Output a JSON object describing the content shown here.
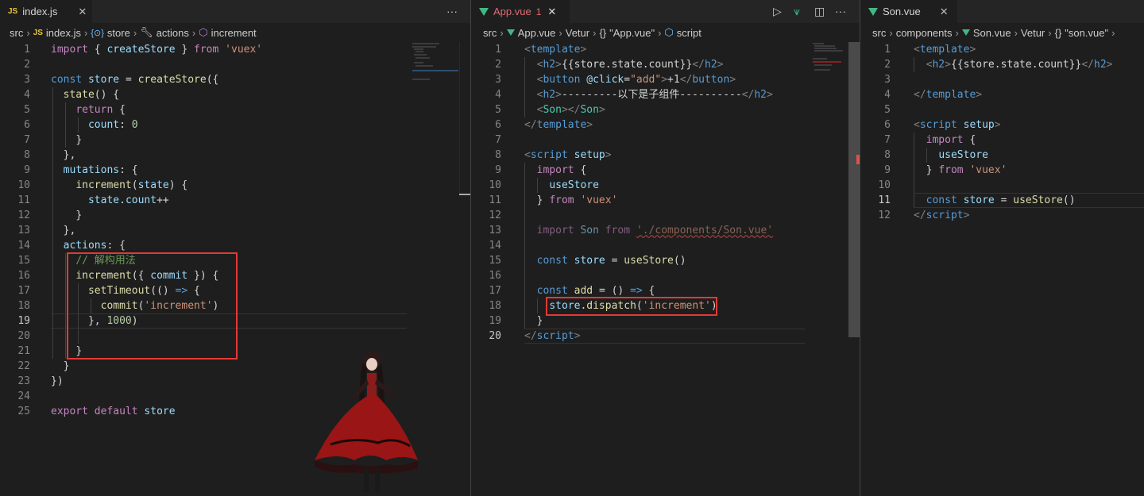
{
  "pane1": {
    "tab": {
      "icon": "JS",
      "title": "index.js"
    },
    "more": "···",
    "breadcrumb": [
      "src",
      "JS",
      "index.js",
      "{⊙}",
      "store",
      "actions",
      "increment"
    ],
    "lines": [
      "1",
      "2",
      "3",
      "4",
      "5",
      "6",
      "7",
      "8",
      "9",
      "10",
      "11",
      "12",
      "13",
      "14",
      "15",
      "16",
      "17",
      "18",
      "19",
      "20",
      "21",
      "22",
      "23",
      "24",
      "25"
    ],
    "code": {
      "l1a": "import",
      "l1b": "{ ",
      "l1c": "createStore",
      "l1d": " } ",
      "l1e": "from",
      "l1f": "'vuex'",
      "l3a": "const",
      "l3b": "store",
      "l3c": "=",
      "l3d": "createStore",
      "l3e": "({",
      "l4a": "state",
      "l4b": "() {",
      "l5a": "return",
      "l5b": " {",
      "l6a": "count",
      "l6b": ": ",
      "l6c": "0",
      "l7": "}",
      "l8": "},",
      "l9a": "mutations",
      "l9b": ": {",
      "l10a": "increment",
      "l10b": "(",
      "l10c": "state",
      "l10d": ") {",
      "l11a": "state",
      "l11b": ".",
      "l11c": "count",
      "l11d": "++",
      "l12": "}",
      "l13": "},",
      "l14a": "actions",
      "l14b": ": {",
      "l15": "// 解构用法",
      "l16a": "increment",
      "l16b": "({ ",
      "l16c": "commit",
      "l16d": " }) {",
      "l17a": "setTimeout",
      "l17b": "(() ",
      "l17c": "=>",
      "l17d": " {",
      "l18a": "commit",
      "l18b": "(",
      "l18c": "'increment'",
      "l18d": ")",
      "l19a": "}, ",
      "l19b": "1000",
      "l19c": ")",
      "l21": "}",
      "l22": "}",
      "l23": "})",
      "l25a": "export",
      "l25b": "default",
      "l25c": "store"
    }
  },
  "pane2": {
    "tab": {
      "title": "App.vue",
      "modified": "1"
    },
    "breadcrumb": [
      "src",
      "App.vue",
      "Vetur",
      "{}",
      "\"App.vue\"",
      "script"
    ],
    "lines": [
      "1",
      "2",
      "3",
      "4",
      "5",
      "6",
      "7",
      "8",
      "9",
      "10",
      "11",
      "12",
      "13",
      "14",
      "15",
      "16",
      "17",
      "18",
      "19",
      "20"
    ],
    "code": {
      "l1": "template",
      "l2a": "h2",
      "l2b": "{{store.state.count}}",
      "l2c": "h2",
      "l3a": "button",
      "l3b": "@click",
      "l3c": "=",
      "l3d": "\"add\"",
      "l3e": "+1",
      "l3f": "button",
      "l4a": "h2",
      "l4b": "---------以下是子组件----------",
      "l4c": "h2",
      "l5a": "Son",
      "l5b": "Son",
      "l6": "template",
      "l8a": "script",
      "l8b": "setup",
      "l9a": "import",
      "l9b": " {",
      "l10": "useStore",
      "l11a": "} ",
      "l11b": "from",
      "l11c": "'vuex'",
      "l13a": "import",
      "l13b": "Son",
      "l13c": "from",
      "l13d": "'./components/Son.vue'",
      "l15a": "const",
      "l15b": "store",
      "l15c": "=",
      "l15d": "useStore",
      "l15e": "()",
      "l17a": "const",
      "l17b": "add",
      "l17c": "= () ",
      "l17d": "=>",
      "l17e": " {",
      "l18a": "store",
      "l18b": ".",
      "l18c": "dispatch",
      "l18d": "(",
      "l18e": "'increment'",
      "l18f": ")",
      "l19": "}",
      "l20": "script"
    }
  },
  "pane3": {
    "tab": {
      "title": "Son.vue"
    },
    "breadcrumb": [
      "src",
      "components",
      "Son.vue",
      "Vetur",
      "{}",
      "\"son.vue\""
    ],
    "lines": [
      "1",
      "2",
      "3",
      "4",
      "5",
      "6",
      "7",
      "8",
      "9",
      "10",
      "11",
      "12"
    ],
    "code": {
      "l1": "template",
      "l2a": "h2",
      "l2b": "{{store.state.count}}",
      "l2c": "h2",
      "l4": "template",
      "l6a": "script",
      "l6b": "setup",
      "l7a": "import",
      "l7b": " {",
      "l8": "useStore",
      "l9a": "} ",
      "l9b": "from",
      "l9c": "'vuex'",
      "l11a": "const",
      "l11b": "store",
      "l11c": "=",
      "l11d": "useStore",
      "l11e": "()",
      "l12": "script"
    }
  }
}
